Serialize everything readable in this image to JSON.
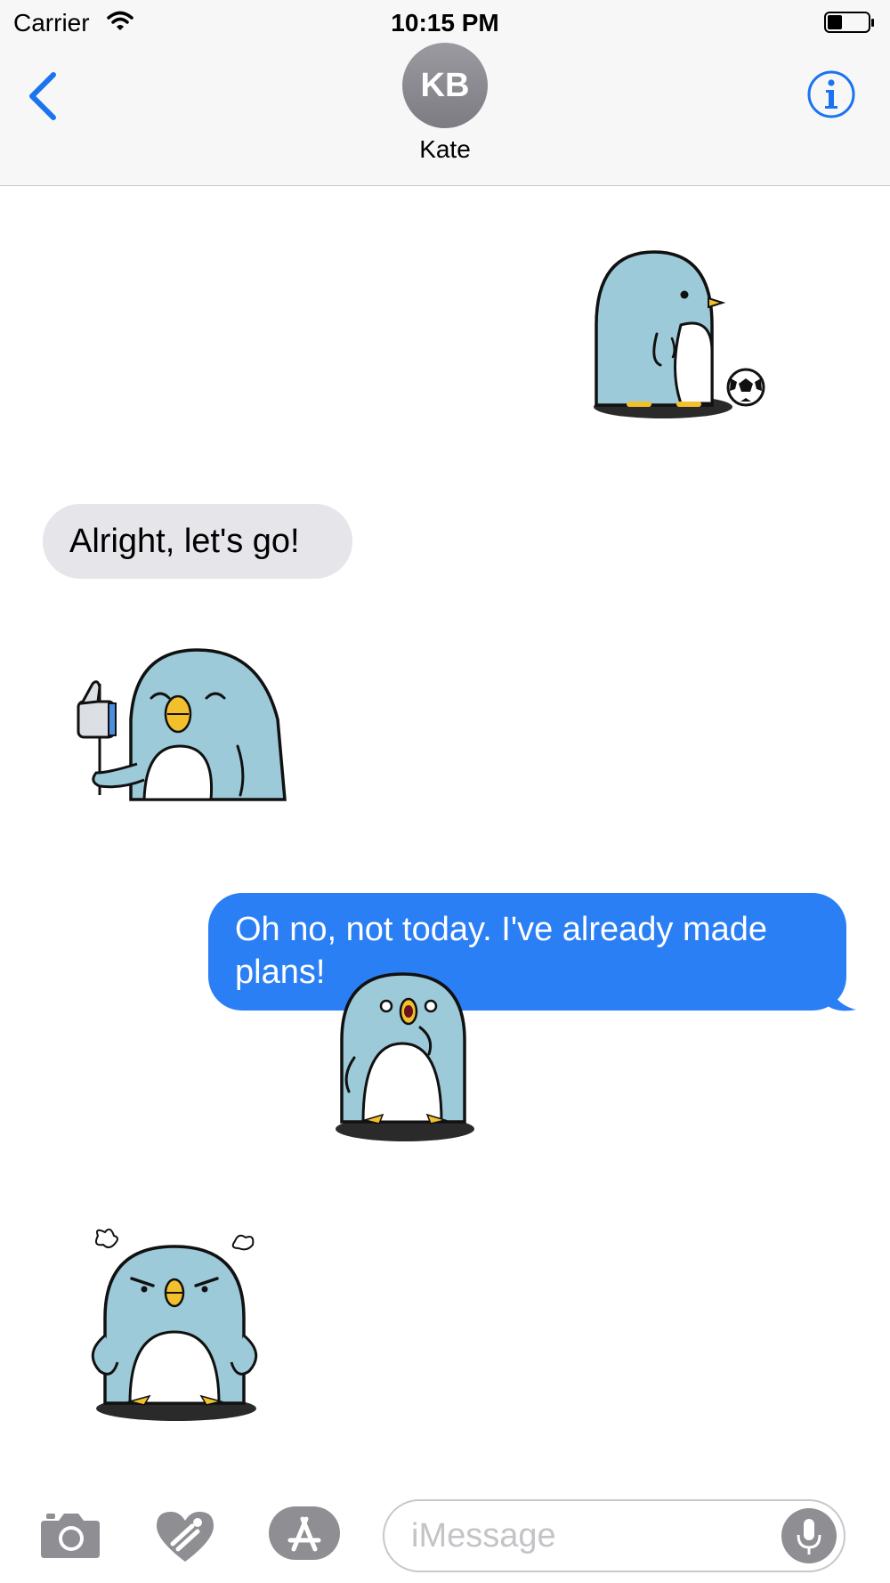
{
  "status_bar": {
    "carrier": "Carrier",
    "time": "10:15 PM",
    "wifi_icon": "wifi-icon",
    "battery_icon": "battery-icon"
  },
  "nav": {
    "back_icon": "chevron-left-icon",
    "avatar_initials": "KB",
    "contact_name": "Kate",
    "info_icon": "info-icon"
  },
  "messages": [
    {
      "type": "sticker",
      "direction": "outgoing",
      "sticker": "penguin-soccer-ball"
    },
    {
      "type": "text",
      "direction": "incoming",
      "text": "Alright, let's go!"
    },
    {
      "type": "sticker",
      "direction": "incoming",
      "sticker": "penguin-thumbs-up-sign"
    },
    {
      "type": "text",
      "direction": "outgoing",
      "text": "Oh no, not today. I've already made plans!"
    },
    {
      "type": "sticker",
      "direction": "outgoing",
      "sticker": "penguin-surprised"
    },
    {
      "type": "sticker",
      "direction": "incoming",
      "sticker": "penguin-angry"
    }
  ],
  "toolbar": {
    "camera_icon": "camera-icon",
    "digital_touch_icon": "heart-touch-icon",
    "app_store_icon": "app-store-icon",
    "input_placeholder": "iMessage",
    "mic_icon": "microphone-icon"
  },
  "colors": {
    "accent": "#1a73f0",
    "outgoing_bubble": "#2b7ff5",
    "incoming_bubble": "#e5e5ea",
    "penguin_body": "#9ccad8"
  }
}
